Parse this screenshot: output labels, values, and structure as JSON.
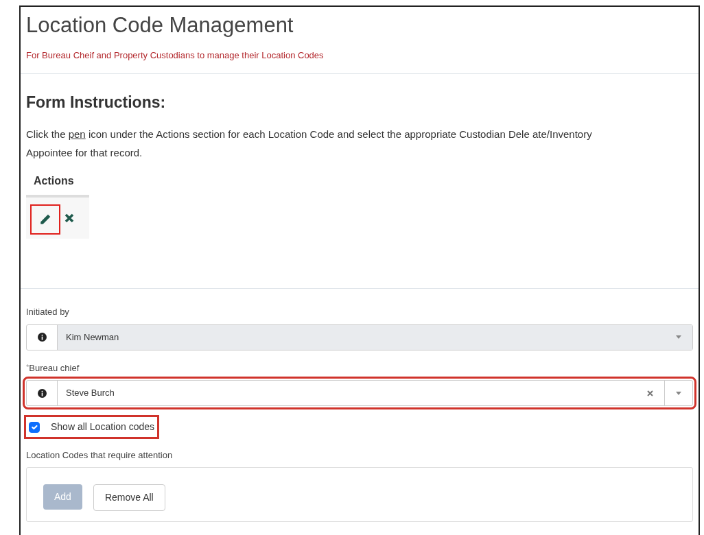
{
  "header": {
    "title": "Location Code Management",
    "subtitle": "For Bureau Cheif and Property Custodians to manage their Location Codes"
  },
  "instructions": {
    "heading": "Form Instructions:",
    "text_before": "Click the ",
    "link": "pen",
    "text_after": " icon under the Actions section for each Location Code and select the appropriate Custodian Dele ate/Inventory Appointee for that record."
  },
  "actions_table": {
    "column": "Actions",
    "highlighted": true
  },
  "fields": [
    {
      "label": "Initiated by",
      "value": "Kim Newman",
      "disabled": true,
      "clearable": false,
      "highlighted": false
    },
    {
      "label": "Bureau chief",
      "required_mark": "*",
      "value": "Steve Burch",
      "disabled": false,
      "clearable": true,
      "highlighted": true
    }
  ],
  "show_all": {
    "label": "Show all Location codes",
    "checked": true,
    "highlighted": true
  },
  "location_codes": {
    "label": "Location Codes that require attention",
    "buttons": [
      {
        "label": "Add",
        "disabled": true
      },
      {
        "label": "Remove All",
        "disabled": false
      }
    ]
  }
}
